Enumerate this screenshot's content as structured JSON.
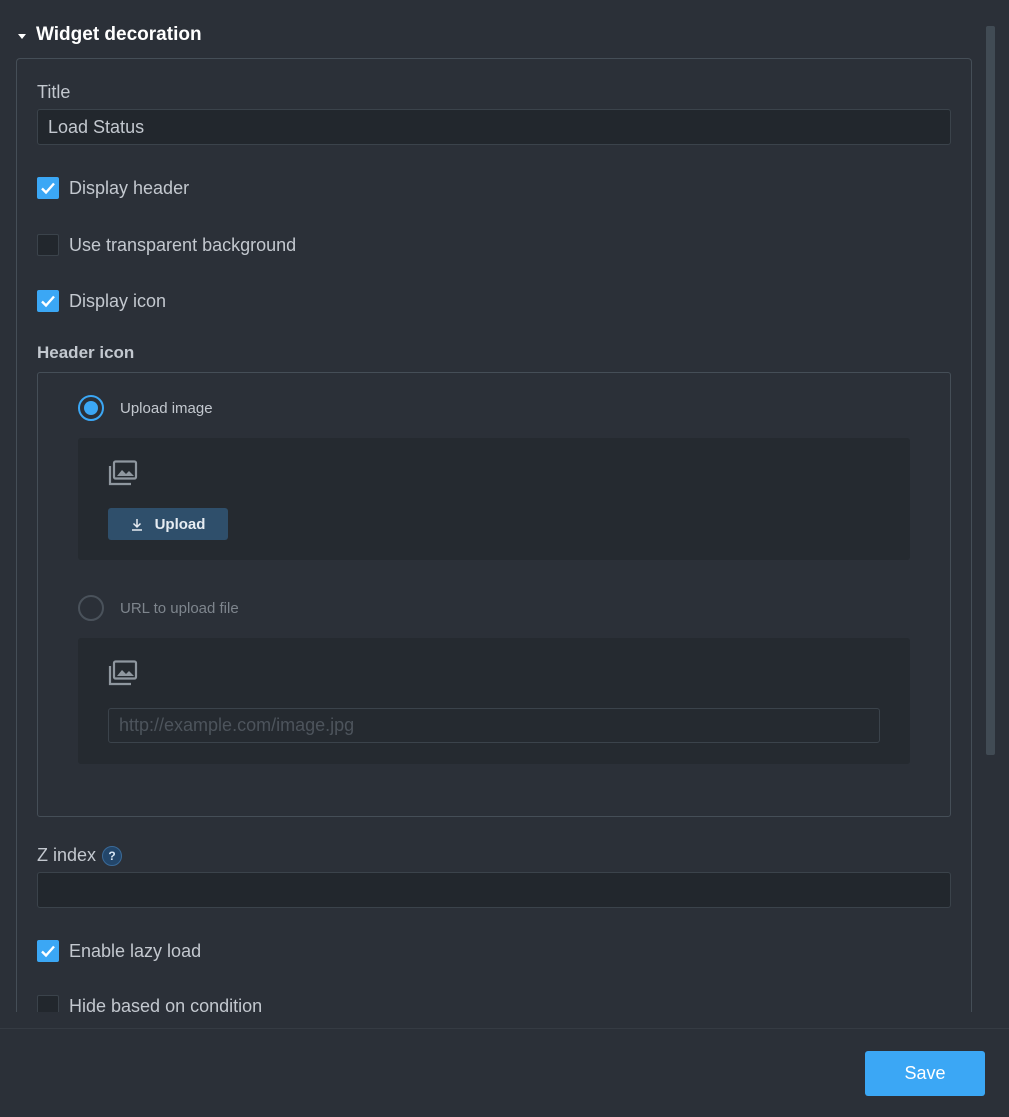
{
  "section": {
    "title": "Widget decoration"
  },
  "title_field": {
    "label": "Title",
    "value": "Load Status"
  },
  "checkboxes": {
    "display_header": {
      "label": "Display header",
      "checked": true
    },
    "transparent_bg": {
      "label": "Use transparent background",
      "checked": false
    },
    "display_icon": {
      "label": "Display icon",
      "checked": true
    },
    "lazy_load": {
      "label": "Enable lazy load",
      "checked": true
    },
    "hide_condition": {
      "label": "Hide based on condition",
      "checked": false
    }
  },
  "header_icon": {
    "label": "Header icon",
    "upload_option": {
      "label": "Upload image",
      "selected": true
    },
    "upload_button_label": "Upload",
    "url_option": {
      "label": "URL to upload file",
      "selected": false
    },
    "url_placeholder": "http://example.com/image.jpg"
  },
  "z_index": {
    "label": "Z index",
    "help": "?",
    "value": ""
  },
  "footer": {
    "save_label": "Save"
  },
  "colors": {
    "accent": "#3ba7f5",
    "background": "#2b3038",
    "input_bg": "#22272d"
  }
}
